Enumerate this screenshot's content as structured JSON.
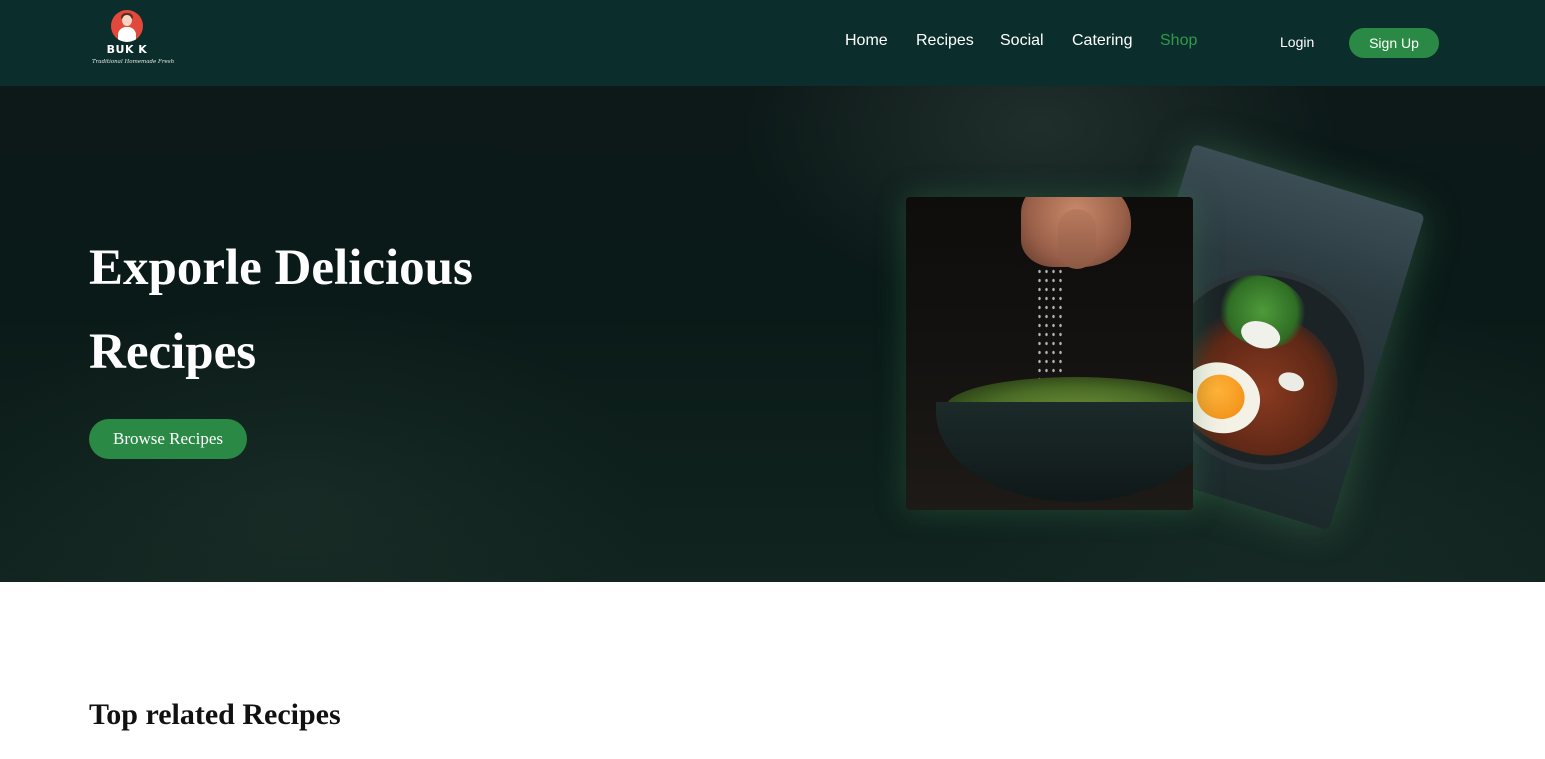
{
  "header": {
    "logo": {
      "name": "BUK K",
      "tagline": "Traditional Homemade Fresh"
    },
    "nav": [
      {
        "label": "Home",
        "active": false
      },
      {
        "label": "Recipes",
        "active": false
      },
      {
        "label": "Social",
        "active": false
      },
      {
        "label": "Catering",
        "active": false
      },
      {
        "label": "Shop",
        "active": true
      }
    ],
    "login_label": "Login",
    "signup_label": "Sign Up"
  },
  "hero": {
    "title": "Exporle Delicious Recipes",
    "browse_label": "Browse Recipes",
    "images": [
      "sprinkling-salt-on-edamame-photo",
      "shakshuka-egg-plate-photo"
    ]
  },
  "main": {
    "section_title": "Top related Recipes"
  },
  "colors": {
    "header_bg": "#0b2e2c",
    "accent_green": "#2a8a45",
    "active_link": "#2e9a4a",
    "hero_bg": "#0c1918"
  }
}
